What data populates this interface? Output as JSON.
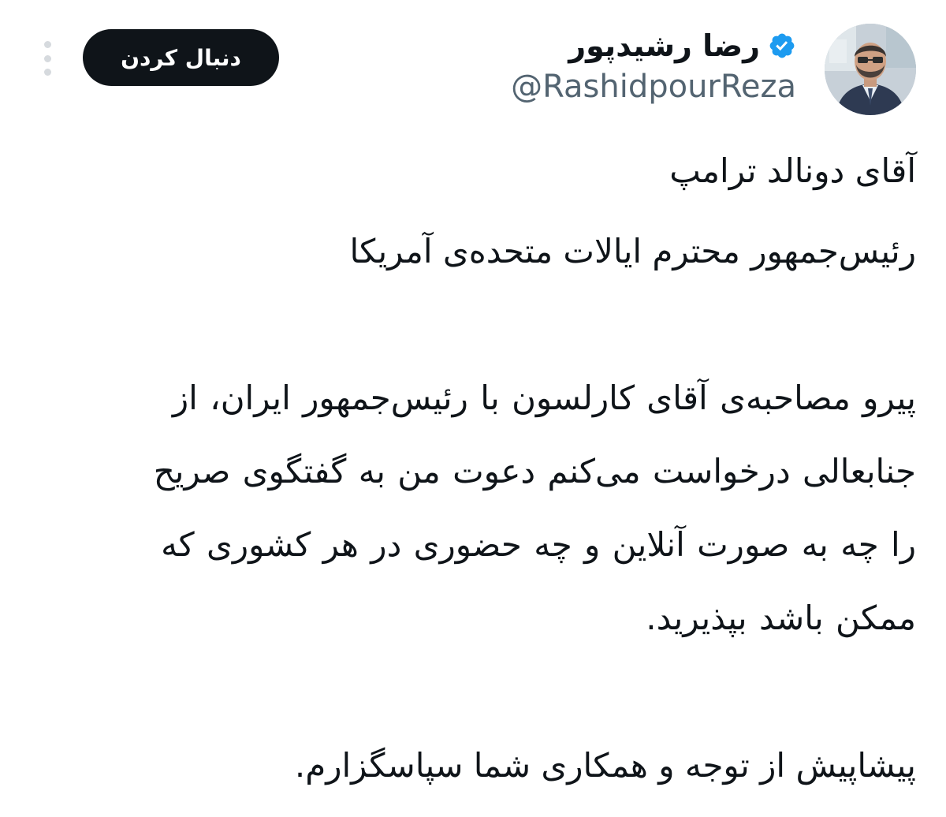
{
  "author": {
    "display_name": "رضا رشیدپور",
    "handle": "@RashidpourReza",
    "verified": true,
    "verified_color": "#1d9bf0"
  },
  "actions": {
    "follow_label": "دنبال کردن",
    "more_icon": "vertical-ellipsis-icon"
  },
  "tweet": {
    "line1": "آقای دونالد ترامپ",
    "line2": "رئیس‌جمهور محترم ایالات متحده‌ی آمریکا",
    "paragraph_lines": [
      "پیرو مصاحبه‌ی آقای کارلسون با رئیس‌جمهور ایران، از",
      "جنابعالی درخواست می‌کنم دعوت من به گفتگوی صریح",
      "را چه به صورت آنلاین و چه حضوری در هر کشوری که",
      "ممکن باشد بپذیرید."
    ],
    "closing": "پیشاپیش از توجه و همکاری شما سپاسگزارم."
  }
}
